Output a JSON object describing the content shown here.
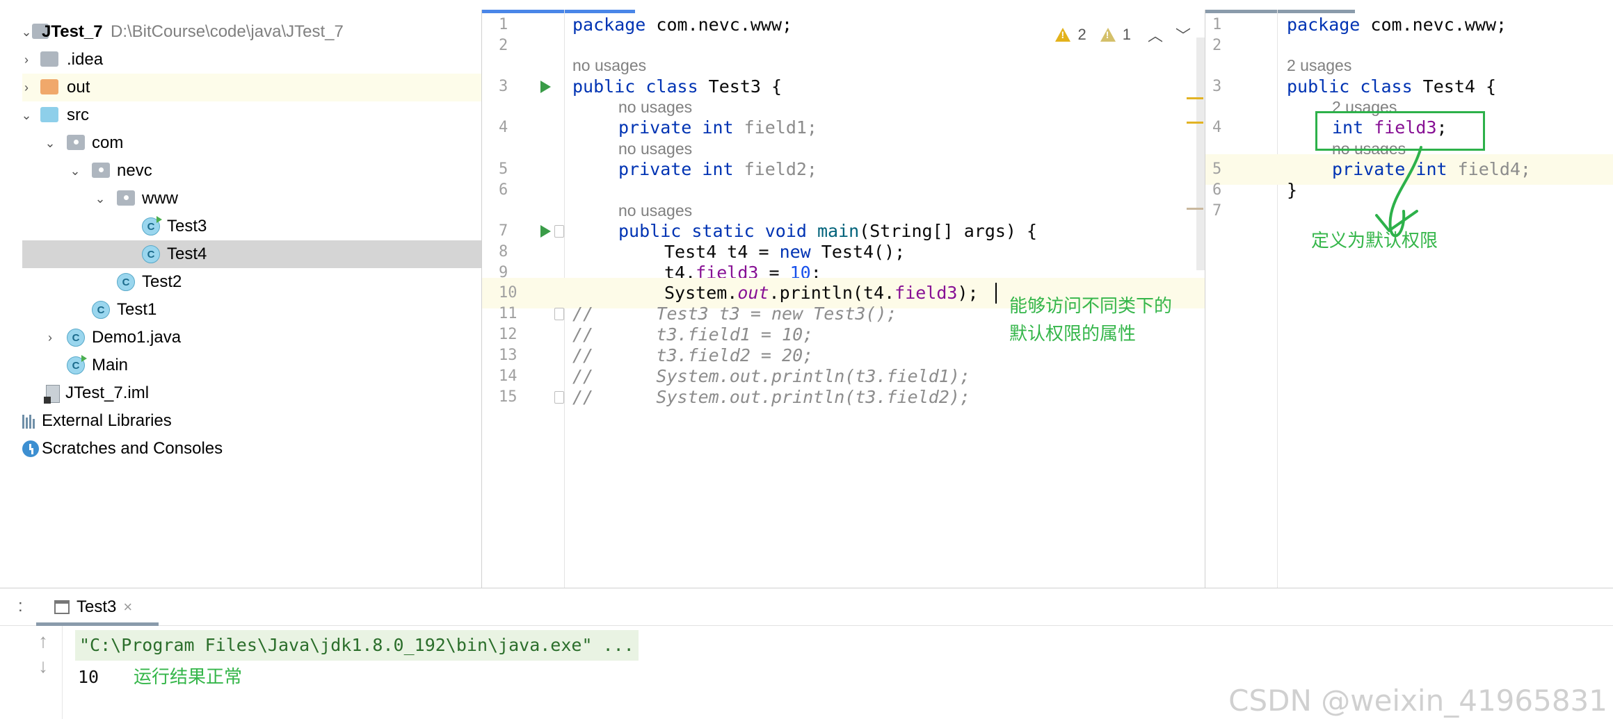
{
  "project": {
    "root_name": "JTest_7",
    "root_path": "D:\\BitCourse\\code\\java\\JTest_7",
    "nodes": {
      "idea": ".idea",
      "out": "out",
      "src": "src",
      "com": "com",
      "nevc": "nevc",
      "www": "www",
      "test3": "Test3",
      "test4": "Test4",
      "test2": "Test2",
      "test1": "Test1",
      "demo1": "Demo1.java",
      "main": "Main",
      "iml": "JTest_7.iml",
      "external": "External Libraries",
      "scratches": "Scratches and Consoles"
    },
    "class_icon_letter": "C"
  },
  "inspections": {
    "warnings": "2",
    "weak_warnings": "1",
    "up_glyph": "^",
    "down_glyph": "v"
  },
  "editor_left": {
    "file": "Test3",
    "line_numbers": [
      "1",
      "2",
      "3",
      "4",
      "5",
      "6",
      "7",
      "8",
      "9",
      "10",
      "11",
      "12",
      "13",
      "14",
      "15"
    ],
    "usages": {
      "class": "no usages",
      "field1": "no usages",
      "field2": "no usages",
      "main": "no usages"
    },
    "code": {
      "l1_kw": "package",
      "l1_rest": " com.nevc.www;",
      "l3_kw": "public class",
      "l3_rest": " Test3 {",
      "l4_kw": "private int",
      "l4_rest": " field1;",
      "l5_kw": "private int",
      "l5_rest": " field2;",
      "l7_kw": "public static void",
      "l7_fn": " main",
      "l7_rest": "(String[] args) {",
      "l8_a": "Test4 t4 = ",
      "l8_kw": "new",
      "l8_b": " Test4();",
      "l9_a": "t4.",
      "l9_fld": "field3",
      "l9_b": " = ",
      "l9_num": "10",
      "l9_c": ";",
      "l10_a": "System.",
      "l10_out": "out",
      "l10_b": ".println(t4.",
      "l10_fld": "field3",
      "l10_c": ");",
      "l11": "//      Test3 t3 = new Test3();",
      "l12": "//      t3.field1 = 10;",
      "l13": "//      t3.field2 = 20;",
      "l14": "//      System.out.println(t3.field1);",
      "l15": "//      System.out.println(t3.field2);"
    },
    "annotation_line1": "能够访问不同类下的",
    "annotation_line2": "默认权限的属性"
  },
  "editor_right": {
    "file": "Test4",
    "line_numbers": [
      "1",
      "2",
      "3",
      "4",
      "5",
      "6",
      "7"
    ],
    "usages": {
      "class": "2 usages",
      "field3": "2 usages",
      "field4": "no usages"
    },
    "code": {
      "l1_kw": "package",
      "l1_rest": " com.nevc.www;",
      "l3_kw": "public class",
      "l3_rest": " Test4 {",
      "l4_kw": "int",
      "l4_fld": " field3",
      "l4_rest": ";",
      "l5_kw": "private int",
      "l5_rest": " field4;",
      "l6": "}"
    },
    "annotation": "定义为默认权限"
  },
  "run": {
    "colon": ":",
    "tab_label": "Test3",
    "close_glyph": "×",
    "up_glyph": "↑",
    "down_glyph": "↓",
    "command": "\"C:\\Program Files\\Java\\jdk1.8.0_192\\bin\\java.exe\" ...",
    "output": "10",
    "annotation": "运行结果正常"
  },
  "watermark": "CSDN @weixin_41965831",
  "colors": {
    "annotation_green": "#35b64a",
    "keyword": "#0033b3",
    "field": "#871094",
    "number": "#1750eb",
    "selection": "#d5d5d5"
  }
}
